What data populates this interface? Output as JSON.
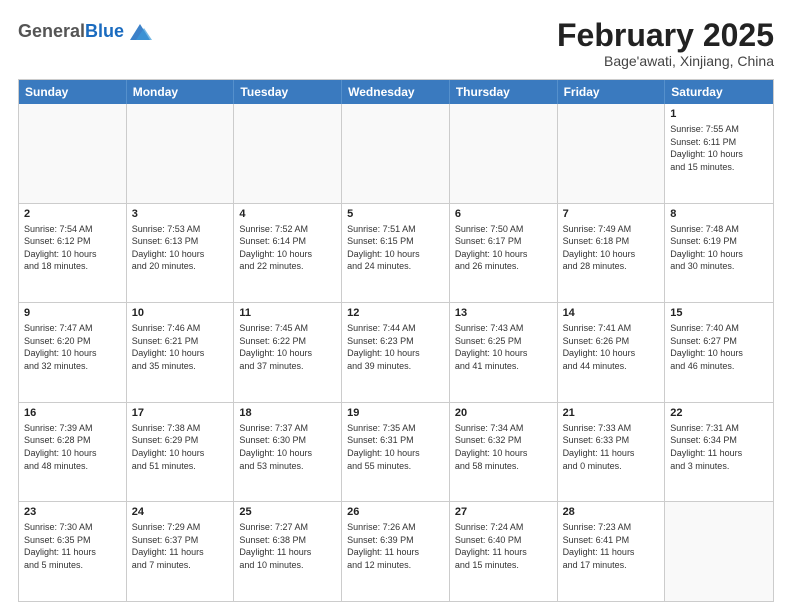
{
  "header": {
    "logo": {
      "general": "General",
      "blue": "Blue"
    },
    "title": "February 2025",
    "location": "Bage'awati, Xinjiang, China"
  },
  "weekdays": [
    "Sunday",
    "Monday",
    "Tuesday",
    "Wednesday",
    "Thursday",
    "Friday",
    "Saturday"
  ],
  "weeks": [
    [
      {
        "day": "",
        "info": ""
      },
      {
        "day": "",
        "info": ""
      },
      {
        "day": "",
        "info": ""
      },
      {
        "day": "",
        "info": ""
      },
      {
        "day": "",
        "info": ""
      },
      {
        "day": "",
        "info": ""
      },
      {
        "day": "1",
        "info": "Sunrise: 7:55 AM\nSunset: 6:11 PM\nDaylight: 10 hours\nand 15 minutes."
      }
    ],
    [
      {
        "day": "2",
        "info": "Sunrise: 7:54 AM\nSunset: 6:12 PM\nDaylight: 10 hours\nand 18 minutes."
      },
      {
        "day": "3",
        "info": "Sunrise: 7:53 AM\nSunset: 6:13 PM\nDaylight: 10 hours\nand 20 minutes."
      },
      {
        "day": "4",
        "info": "Sunrise: 7:52 AM\nSunset: 6:14 PM\nDaylight: 10 hours\nand 22 minutes."
      },
      {
        "day": "5",
        "info": "Sunrise: 7:51 AM\nSunset: 6:15 PM\nDaylight: 10 hours\nand 24 minutes."
      },
      {
        "day": "6",
        "info": "Sunrise: 7:50 AM\nSunset: 6:17 PM\nDaylight: 10 hours\nand 26 minutes."
      },
      {
        "day": "7",
        "info": "Sunrise: 7:49 AM\nSunset: 6:18 PM\nDaylight: 10 hours\nand 28 minutes."
      },
      {
        "day": "8",
        "info": "Sunrise: 7:48 AM\nSunset: 6:19 PM\nDaylight: 10 hours\nand 30 minutes."
      }
    ],
    [
      {
        "day": "9",
        "info": "Sunrise: 7:47 AM\nSunset: 6:20 PM\nDaylight: 10 hours\nand 32 minutes."
      },
      {
        "day": "10",
        "info": "Sunrise: 7:46 AM\nSunset: 6:21 PM\nDaylight: 10 hours\nand 35 minutes."
      },
      {
        "day": "11",
        "info": "Sunrise: 7:45 AM\nSunset: 6:22 PM\nDaylight: 10 hours\nand 37 minutes."
      },
      {
        "day": "12",
        "info": "Sunrise: 7:44 AM\nSunset: 6:23 PM\nDaylight: 10 hours\nand 39 minutes."
      },
      {
        "day": "13",
        "info": "Sunrise: 7:43 AM\nSunset: 6:25 PM\nDaylight: 10 hours\nand 41 minutes."
      },
      {
        "day": "14",
        "info": "Sunrise: 7:41 AM\nSunset: 6:26 PM\nDaylight: 10 hours\nand 44 minutes."
      },
      {
        "day": "15",
        "info": "Sunrise: 7:40 AM\nSunset: 6:27 PM\nDaylight: 10 hours\nand 46 minutes."
      }
    ],
    [
      {
        "day": "16",
        "info": "Sunrise: 7:39 AM\nSunset: 6:28 PM\nDaylight: 10 hours\nand 48 minutes."
      },
      {
        "day": "17",
        "info": "Sunrise: 7:38 AM\nSunset: 6:29 PM\nDaylight: 10 hours\nand 51 minutes."
      },
      {
        "day": "18",
        "info": "Sunrise: 7:37 AM\nSunset: 6:30 PM\nDaylight: 10 hours\nand 53 minutes."
      },
      {
        "day": "19",
        "info": "Sunrise: 7:35 AM\nSunset: 6:31 PM\nDaylight: 10 hours\nand 55 minutes."
      },
      {
        "day": "20",
        "info": "Sunrise: 7:34 AM\nSunset: 6:32 PM\nDaylight: 10 hours\nand 58 minutes."
      },
      {
        "day": "21",
        "info": "Sunrise: 7:33 AM\nSunset: 6:33 PM\nDaylight: 11 hours\nand 0 minutes."
      },
      {
        "day": "22",
        "info": "Sunrise: 7:31 AM\nSunset: 6:34 PM\nDaylight: 11 hours\nand 3 minutes."
      }
    ],
    [
      {
        "day": "23",
        "info": "Sunrise: 7:30 AM\nSunset: 6:35 PM\nDaylight: 11 hours\nand 5 minutes."
      },
      {
        "day": "24",
        "info": "Sunrise: 7:29 AM\nSunset: 6:37 PM\nDaylight: 11 hours\nand 7 minutes."
      },
      {
        "day": "25",
        "info": "Sunrise: 7:27 AM\nSunset: 6:38 PM\nDaylight: 11 hours\nand 10 minutes."
      },
      {
        "day": "26",
        "info": "Sunrise: 7:26 AM\nSunset: 6:39 PM\nDaylight: 11 hours\nand 12 minutes."
      },
      {
        "day": "27",
        "info": "Sunrise: 7:24 AM\nSunset: 6:40 PM\nDaylight: 11 hours\nand 15 minutes."
      },
      {
        "day": "28",
        "info": "Sunrise: 7:23 AM\nSunset: 6:41 PM\nDaylight: 11 hours\nand 17 minutes."
      },
      {
        "day": "",
        "info": ""
      }
    ]
  ]
}
